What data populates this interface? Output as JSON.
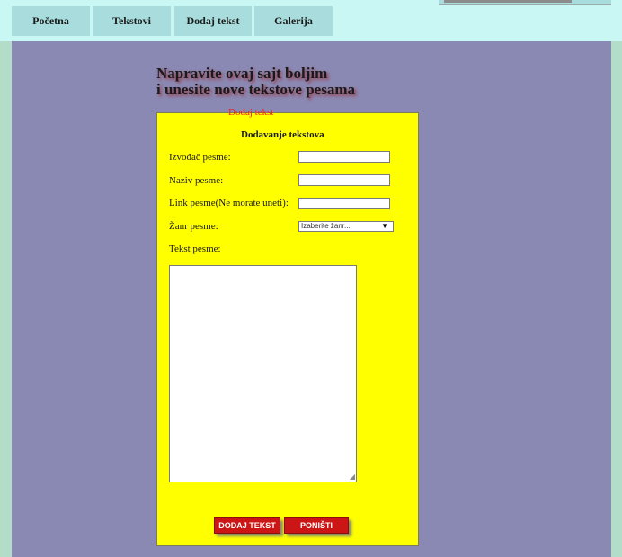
{
  "nav": {
    "items": [
      {
        "label": "Početna"
      },
      {
        "label": "Tekstovi"
      },
      {
        "label": "Dodaj tekst"
      },
      {
        "label": "Galerija"
      }
    ]
  },
  "heading": {
    "line1": "Napravite ovaj sajt boljim",
    "line2": "i unesite nove tekstove pesama"
  },
  "form": {
    "legend": "Dodaj tekst",
    "title": "Dodavanje tekstova",
    "fields": {
      "artist_label": "Izvođač pesme:",
      "artist_value": "",
      "name_label": "Naziv pesme:",
      "name_value": "",
      "link_label": "Link pesme(Ne morate uneti):",
      "link_value": "",
      "genre_label": "Žanr pesme:",
      "genre_selected": "Izaberite žanr...",
      "lyrics_label": "Tekst pesme:",
      "lyrics_value": ""
    },
    "buttons": {
      "submit": "DODAJ TEKST",
      "reset": "PONIŠTI"
    }
  },
  "colors": {
    "topbar": "#c9f7f3",
    "nav_tab": "#a9dcdc",
    "main_bg": "#8a89b3",
    "panel_bg": "#ffff00",
    "legend": "#ff1a1a",
    "button": "#cc1616"
  }
}
